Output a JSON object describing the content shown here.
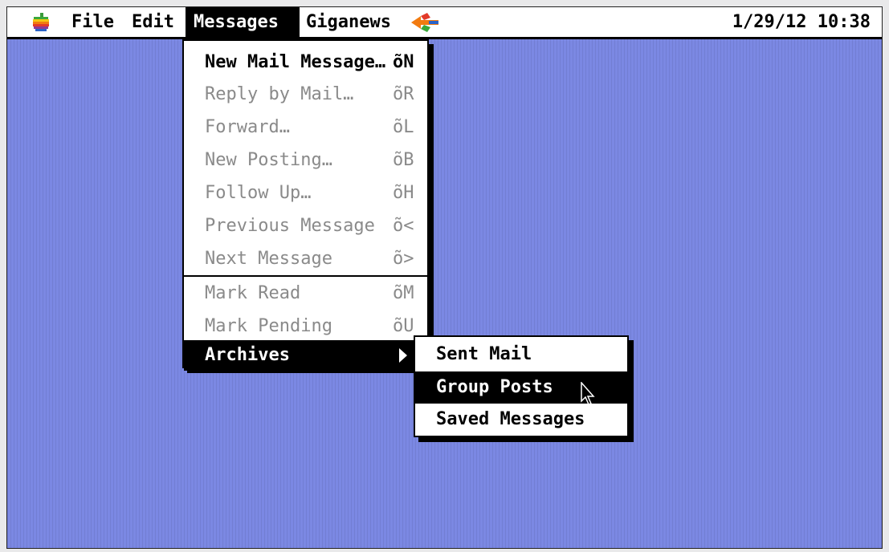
{
  "menubar": {
    "apple_icon": "apple-logo-icon",
    "menus": [
      {
        "label": "File"
      },
      {
        "label": "Edit"
      },
      {
        "label": "Messages"
      },
      {
        "label": "Giganews"
      }
    ],
    "spin_icon": "spinner-icon",
    "clock": "1/29/12 10:38"
  },
  "messages_menu": {
    "items": [
      {
        "label": "New Mail Message…",
        "shortcut": "õN"
      },
      {
        "label": "Reply by Mail…",
        "shortcut": "õR"
      },
      {
        "label": "Forward…",
        "shortcut": "õL"
      },
      {
        "label": "New Posting…",
        "shortcut": "õB"
      },
      {
        "label": "Follow Up…",
        "shortcut": "õH"
      },
      {
        "label": "Previous Message",
        "shortcut": "õ<"
      },
      {
        "label": "Next Message",
        "shortcut": "õ>"
      },
      {
        "label": "Mark Read",
        "shortcut": "õM"
      },
      {
        "label": "Mark Pending",
        "shortcut": "õU"
      },
      {
        "label": "Archives",
        "submenu": true
      }
    ]
  },
  "archives_submenu": {
    "items": [
      {
        "label": "Sent Mail"
      },
      {
        "label": "Group Posts"
      },
      {
        "label": "Saved Messages"
      }
    ]
  },
  "colors": {
    "desktop": "#7b88e3",
    "menu_bg": "#ffffff",
    "highlight": "#000000",
    "disabled_text": "#8a8a8a"
  }
}
